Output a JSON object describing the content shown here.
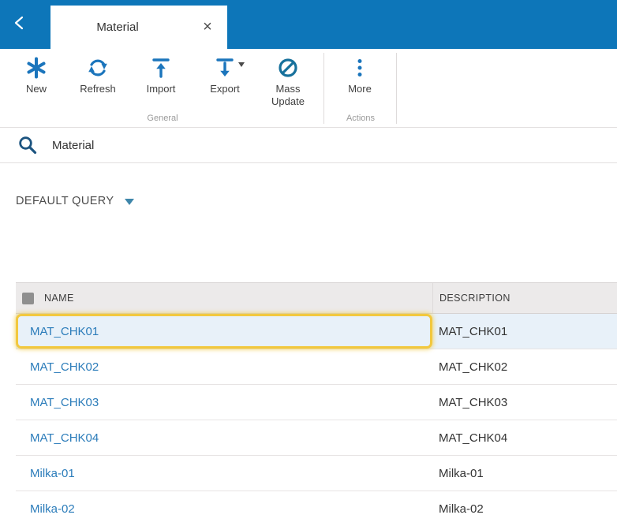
{
  "header": {
    "tab": {
      "title": "Material",
      "close": "×"
    }
  },
  "toolbar": {
    "buttons": [
      {
        "label": "New",
        "icon": "asterisk-icon"
      },
      {
        "label": "Refresh",
        "icon": "refresh-icon"
      },
      {
        "label": "Import",
        "icon": "import-icon"
      },
      {
        "label": "Export",
        "icon": "export-icon",
        "has_dropdown": true
      },
      {
        "label": "Mass Update",
        "icon": "mass-update-icon"
      },
      {
        "label": "More",
        "icon": "more-icon"
      }
    ],
    "groups": [
      {
        "label": "General"
      },
      {
        "label": "Actions"
      }
    ]
  },
  "search": {
    "value": "Material"
  },
  "query_selector": {
    "label": "DEFAULT QUERY"
  },
  "table": {
    "columns": [
      {
        "label": "NAME"
      },
      {
        "label": "DESCRIPTION"
      }
    ],
    "rows": [
      {
        "name": "MAT_CHK01",
        "description": "MAT_CHK01"
      },
      {
        "name": "MAT_CHK02",
        "description": "MAT_CHK02"
      },
      {
        "name": "MAT_CHK03",
        "description": "MAT_CHK03"
      },
      {
        "name": "MAT_CHK04",
        "description": "MAT_CHK04"
      },
      {
        "name": "Milka-01",
        "description": "Milka-01"
      },
      {
        "name": "Milka-02",
        "description": "Milka-02"
      }
    ],
    "selected_row": 0
  },
  "colors": {
    "header_blue": "#0d76b9",
    "icon_blue": "#1b75bc",
    "link_blue": "#2b7cba",
    "highlight_yellow": "#f2c83e",
    "selected_row_bg": "#e8f1f9",
    "table_header_bg": "#eceaea"
  }
}
